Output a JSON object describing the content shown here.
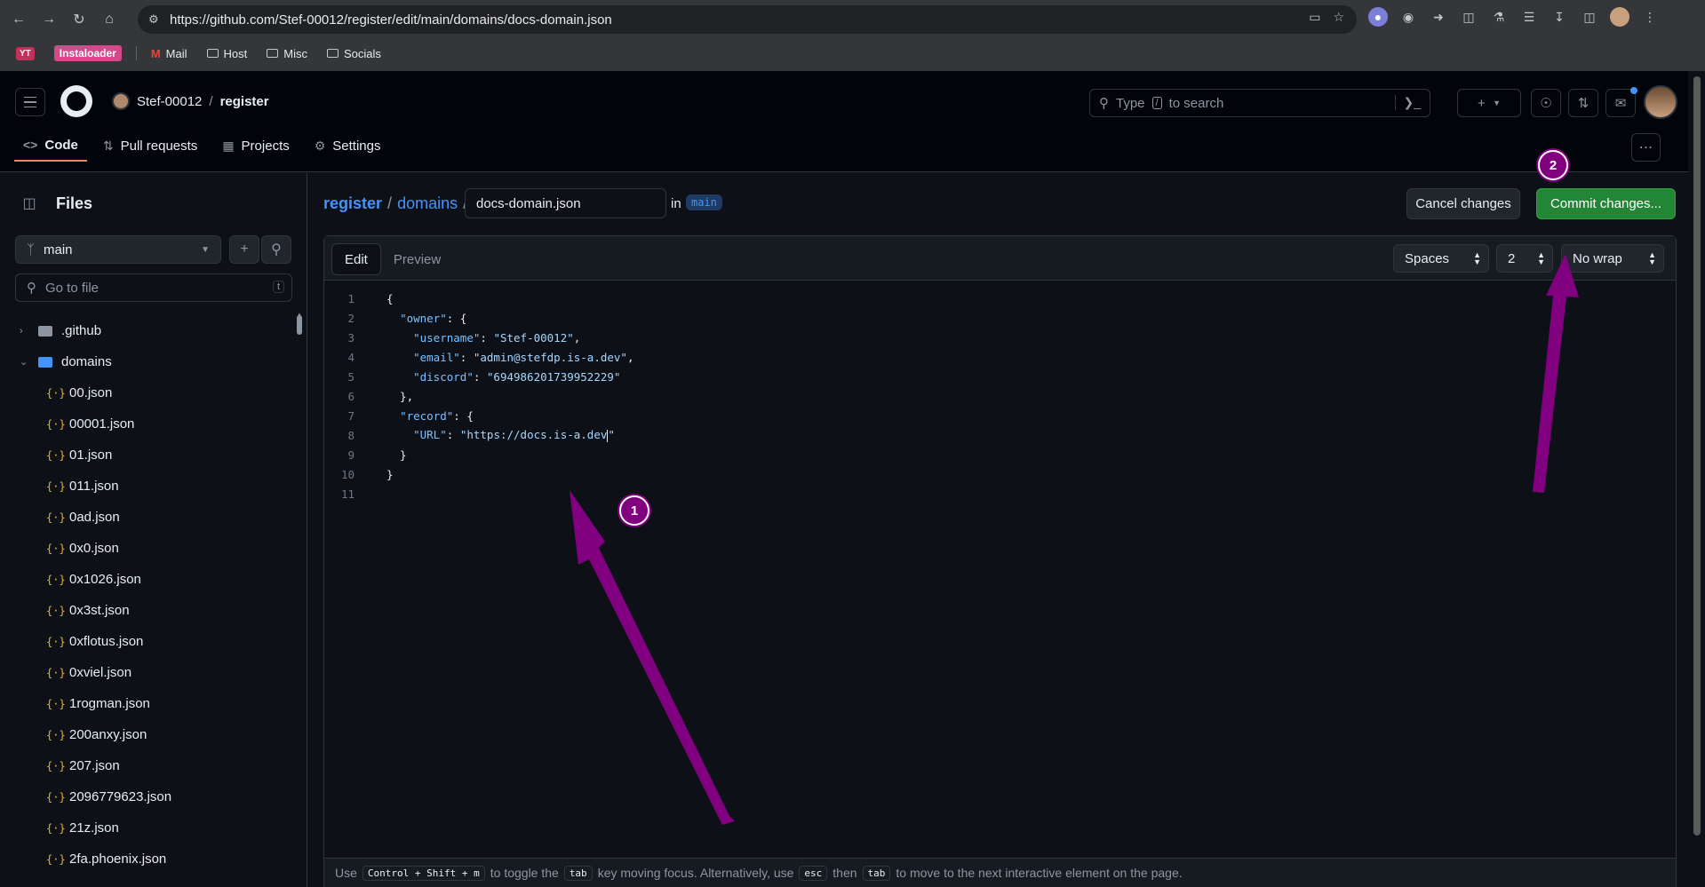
{
  "browser": {
    "url": "https://github.com/Stef-00012/register/edit/main/domains/docs-domain.json",
    "bookmarks": [
      {
        "label": "YT",
        "kind": "yt"
      },
      {
        "label": "Instaloader",
        "kind": "ig"
      },
      {
        "label": "Mail",
        "kind": "mail"
      },
      {
        "label": "Host",
        "kind": "folder"
      },
      {
        "label": "Misc",
        "kind": "folder"
      },
      {
        "label": "Socials",
        "kind": "folder"
      }
    ]
  },
  "header": {
    "owner": "Stef-00012",
    "separator": "/",
    "repo": "register",
    "search_placeholder_prefix": "Type",
    "search_key": "/",
    "search_placeholder_suffix": "to search",
    "tabs": [
      {
        "label": "Code",
        "icon": "code-icon",
        "active": true
      },
      {
        "label": "Pull requests",
        "icon": "pull-request-icon",
        "active": false
      },
      {
        "label": "Projects",
        "icon": "table-icon",
        "active": false
      },
      {
        "label": "Settings",
        "icon": "gear-icon",
        "active": false
      }
    ]
  },
  "sidebar": {
    "title": "Files",
    "branch": "main",
    "goto_placeholder": "Go to file",
    "goto_key": "t",
    "tree": [
      {
        "label": ".github",
        "type": "folder",
        "collapsed": true
      },
      {
        "label": "domains",
        "type": "folder",
        "collapsed": false
      },
      {
        "label": "00.json",
        "type": "file"
      },
      {
        "label": "00001.json",
        "type": "file"
      },
      {
        "label": "01.json",
        "type": "file"
      },
      {
        "label": "011.json",
        "type": "file"
      },
      {
        "label": "0ad.json",
        "type": "file"
      },
      {
        "label": "0x0.json",
        "type": "file"
      },
      {
        "label": "0x1026.json",
        "type": "file"
      },
      {
        "label": "0x3st.json",
        "type": "file"
      },
      {
        "label": "0xflotus.json",
        "type": "file"
      },
      {
        "label": "0xviel.json",
        "type": "file"
      },
      {
        "label": "1rogman.json",
        "type": "file"
      },
      {
        "label": "200anxy.json",
        "type": "file"
      },
      {
        "label": "207.json",
        "type": "file"
      },
      {
        "label": "2096779623.json",
        "type": "file"
      },
      {
        "label": "21z.json",
        "type": "file"
      },
      {
        "label": "2fa.phoenix.json",
        "type": "file"
      }
    ]
  },
  "main": {
    "crumb_repo": "register",
    "crumb_sep": "/",
    "crumb_folder": "domains",
    "filename": "docs-domain.json",
    "in_label": "in",
    "branch": "main",
    "cancel_label": "Cancel changes",
    "commit_label": "Commit changes...",
    "edit_tab": "Edit",
    "preview_tab": "Preview",
    "indent_mode": "Spaces",
    "indent_size": "2",
    "wrap_mode": "No wrap",
    "hint": {
      "use": "Use",
      "combo": "Control + Shift + m",
      "toggle": "to toggle the",
      "tab_key": "tab",
      "moving": "key moving focus. Alternatively, use",
      "esc_key": "esc",
      "then": "then",
      "tab_key2": "tab",
      "rest": "to move to the next interactive element on the page."
    }
  },
  "code_lines": [
    {
      "n": "1",
      "text": "{"
    },
    {
      "n": "2",
      "text": "  \"owner\": {"
    },
    {
      "n": "3",
      "text": "    \"username\": \"Stef-00012\","
    },
    {
      "n": "4",
      "text": "    \"email\": \"admin@stefdp.is-a.dev\","
    },
    {
      "n": "5",
      "text": "    \"discord\": \"694986201739952229\""
    },
    {
      "n": "6",
      "text": "  },"
    },
    {
      "n": "7",
      "text": "  \"record\": {"
    },
    {
      "n": "8",
      "text": "    \"URL\": \"https://docs.is-a.dev\""
    },
    {
      "n": "9",
      "text": "  }"
    },
    {
      "n": "10",
      "text": "}"
    },
    {
      "n": "11",
      "text": ""
    }
  ],
  "annotations": [
    {
      "label": "1",
      "color": "#800080"
    },
    {
      "label": "2",
      "color": "#800080"
    }
  ],
  "colors": {
    "accent_link": "#4493f8",
    "commit_green": "#238636",
    "annotation_purple": "#800080",
    "active_tab_underline": "#f78166"
  }
}
